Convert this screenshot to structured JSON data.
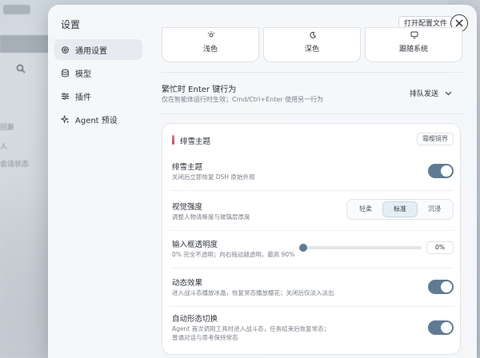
{
  "backdrop": {
    "chip_label": "Aa",
    "side_texts": [
      "回复",
      "人",
      "会话状态"
    ]
  },
  "modal": {
    "title": "设置",
    "open_config_label": "打开配置文件"
  },
  "sidebar": {
    "items": [
      {
        "label": "通用设置",
        "icon": "gear-icon",
        "active": true
      },
      {
        "label": "模型",
        "icon": "database-icon",
        "active": false
      },
      {
        "label": "插件",
        "icon": "sliders-icon",
        "active": false
      },
      {
        "label": "Agent 预设",
        "icon": "sparkle-icon",
        "active": false
      }
    ]
  },
  "theme": {
    "options": [
      {
        "label": "浅色",
        "icon": "sun-icon"
      },
      {
        "label": "深色",
        "icon": "moon-icon"
      },
      {
        "label": "跟随系统",
        "icon": "monitor-icon"
      }
    ]
  },
  "busy_enter": {
    "title": "繁忙时 Enter 键行为",
    "desc": "仅在智能体运行时生效；Cmd/Ctrl+Enter 使用另一行为",
    "value": "排队发送"
  },
  "snow_panel": {
    "title": "绯雪主题",
    "badge": "霜樱镜界",
    "rows": {
      "theme": {
        "title": "绯雪主题",
        "desc": "关闭后立即恢复 DSH 原始外观",
        "on": true
      },
      "intensity": {
        "title": "视觉强度",
        "desc": "调整人物清晰度与玻璃层厚度",
        "options": [
          "轻柔",
          "标准",
          "沉浸"
        ],
        "selected": "标准"
      },
      "opacity": {
        "title": "输入框透明度",
        "desc": "0% 完全不透明；向右拖动越透明，最高 90%",
        "value_label": "0%",
        "value": 0,
        "max": 90
      },
      "motion": {
        "title": "动态效果",
        "desc": "进入战斗态播放冰晶，恢复常态播放樱花；关闭后仅淡入淡出",
        "on": true
      },
      "auto_switch": {
        "title": "自动形态切换",
        "desc": "Agent 首次调用工具时进入战斗态，任务结束后恢复常态；普通对话与思考保持常态",
        "on": true
      }
    }
  },
  "colors": {
    "accent": "#5e7b94",
    "panel_accent": "#c94a5e"
  }
}
